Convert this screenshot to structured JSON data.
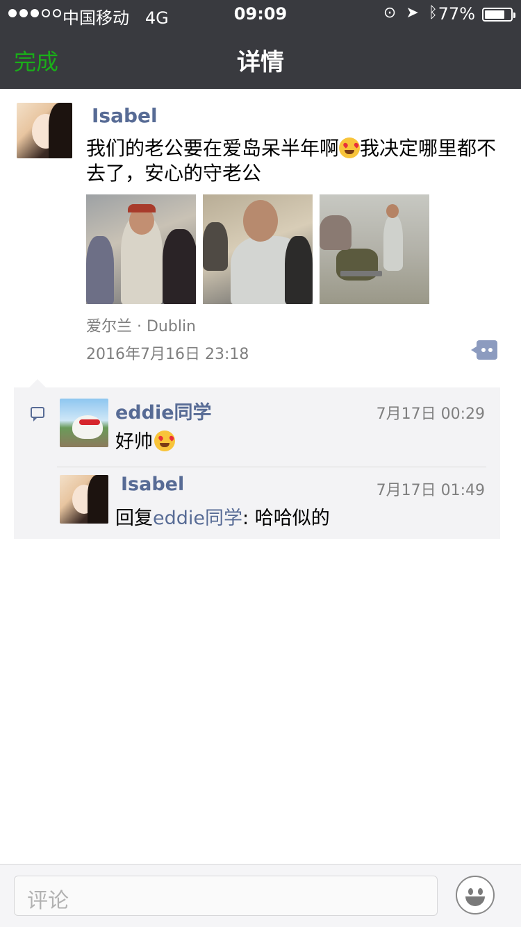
{
  "status_bar": {
    "carrier": "中国移动",
    "network": "4G",
    "time": "09:09",
    "battery_percent": "77%",
    "battery_level": 0.77,
    "signal_bars_filled": 3,
    "signal_bars_total": 5
  },
  "nav": {
    "done_label": "完成",
    "title": "详情"
  },
  "post": {
    "author": "Isabel",
    "text_part1": "我们的老公要在爱岛呆半年啊",
    "text_part2": "我决定哪里都不去了，安心的守老公",
    "emoji": "smiling-face-with-heart-eyes",
    "location": "爱尔兰 · Dublin",
    "timestamp": "2016年7月16日 23:18",
    "photos": [
      "airport-photo-1",
      "airport-photo-2",
      "airport-photo-3"
    ]
  },
  "comments": [
    {
      "author": "eddie同学",
      "time": "7月17日 00:29",
      "text": "好帅",
      "emoji": "smiling-face-with-heart-eyes"
    },
    {
      "author": "Isabel",
      "time": "7月17日 01:49",
      "reply_prefix": "回复",
      "reply_to": "eddie同学",
      "text": ": 哈哈似的"
    }
  ],
  "input": {
    "placeholder": "评论"
  },
  "colors": {
    "nav_bg": "#393a3f",
    "accent_green": "#1aad19",
    "link_blue": "#576b95"
  }
}
